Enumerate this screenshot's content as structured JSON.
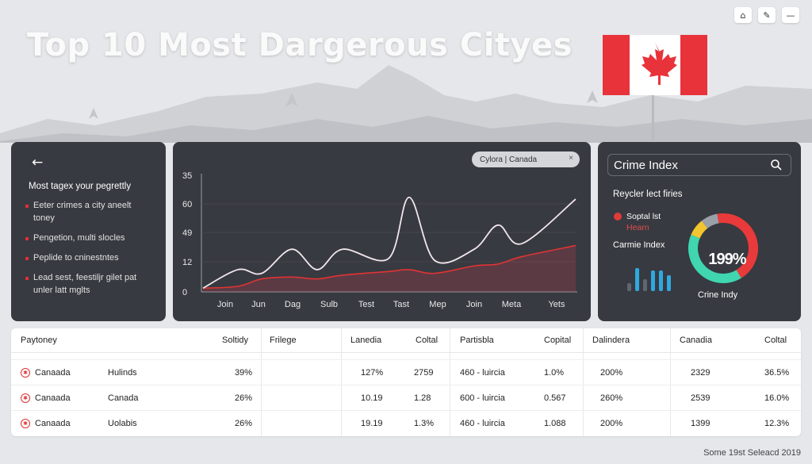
{
  "page": {
    "title": "Top 10 Most Dargerous Cityes",
    "footer": "Some 19st Seleacd 2019"
  },
  "window_controls": [
    {
      "icon": "home-icon",
      "glyph": "⌂"
    },
    {
      "icon": "pen-icon",
      "glyph": "✎"
    },
    {
      "icon": "minimize-icon",
      "glyph": "—"
    }
  ],
  "flag": {
    "country": "Canada",
    "colors": {
      "red": "#e8333a",
      "white": "#ffffff"
    }
  },
  "left_panel": {
    "back_glyph": "←",
    "heading": "Most tagex your pegrettly",
    "items": [
      "Eeter crimes a city aneelt toney",
      "Pengetion, multi slocles",
      "Peplide to cninestntes",
      "Lead sest, feestiljr gilet pat unler latt mglts"
    ]
  },
  "chart_panel": {
    "filter_pill": "Cylora | Canada",
    "close_glyph": "×"
  },
  "chart_data": {
    "type": "line",
    "categories": [
      "Join",
      "Jun",
      "Dag",
      "Sulb",
      "Test",
      "Tast",
      "Mep",
      "Join",
      "Meta",
      "Yets"
    ],
    "y_ticks": [
      "0",
      "12",
      "49",
      "60",
      "35"
    ],
    "series": [
      {
        "color": "#f2e6ec",
        "values": [
          0.2,
          1.2,
          1.0,
          2.3,
          1.2,
          2.3,
          1.8,
          5.1,
          1.7,
          2.3,
          3.6,
          2.6,
          5.0
        ]
      },
      {
        "color": "#e03434",
        "values": [
          0.2,
          0.3,
          0.7,
          0.8,
          0.7,
          0.9,
          1.1,
          1.2,
          1.0,
          1.4,
          1.5,
          1.9,
          2.5
        ]
      }
    ],
    "ylim": [
      0,
      6.2
    ]
  },
  "right_panel": {
    "search_title": "Crime Index",
    "subtitle": "Reycler lect firies",
    "legend_text": "Soptal lst",
    "legend_red": "Hearn",
    "index_label": "Carmie Index",
    "donut_value": "199%",
    "donut_caption": "Crine Indy",
    "donut_segments": [
      {
        "color": "#e83a3a",
        "fraction": 0.44
      },
      {
        "color": "#3fd6b0",
        "fraction": 0.4
      },
      {
        "color": "#f2c530",
        "fraction": 0.08
      },
      {
        "color": "#9aa0a8",
        "fraction": 0.08
      }
    ],
    "mini_bars": [
      {
        "level": 0.3,
        "color": "#5f6670"
      },
      {
        "level": 0.85,
        "color": "#2fa8e0"
      },
      {
        "level": 0.45,
        "color": "#5f6670"
      },
      {
        "level": 0.75,
        "color": "#2fa8e0"
      },
      {
        "level": 0.75,
        "color": "#2fa8e0"
      },
      {
        "level": 0.6,
        "color": "#2fa8e0"
      }
    ]
  },
  "table": {
    "headers": [
      "Paytoney",
      "Soltidy",
      "Frilege",
      "Lanedia",
      "Coltal",
      "Partisbla",
      "Copital",
      "Dalindera",
      "Canadia",
      "Coltal"
    ],
    "rows": [
      [
        "Canaada",
        "Hulinds",
        "39%",
        "",
        "127%",
        "2759",
        "460 - luircia",
        "1.0%",
        "200%",
        "2329",
        "36.5%"
      ],
      [
        "Canaada",
        "Canada",
        "26%",
        "",
        "10.19",
        "1.28",
        "600 - luircia",
        "0.567",
        "260%",
        "2539",
        "16.0%"
      ],
      [
        "Canaada",
        "Uolabis",
        "26%",
        "",
        "19.19",
        "1.3%",
        "460 - luircia",
        "1.088",
        "200%",
        "1399",
        "12.3%"
      ]
    ]
  }
}
